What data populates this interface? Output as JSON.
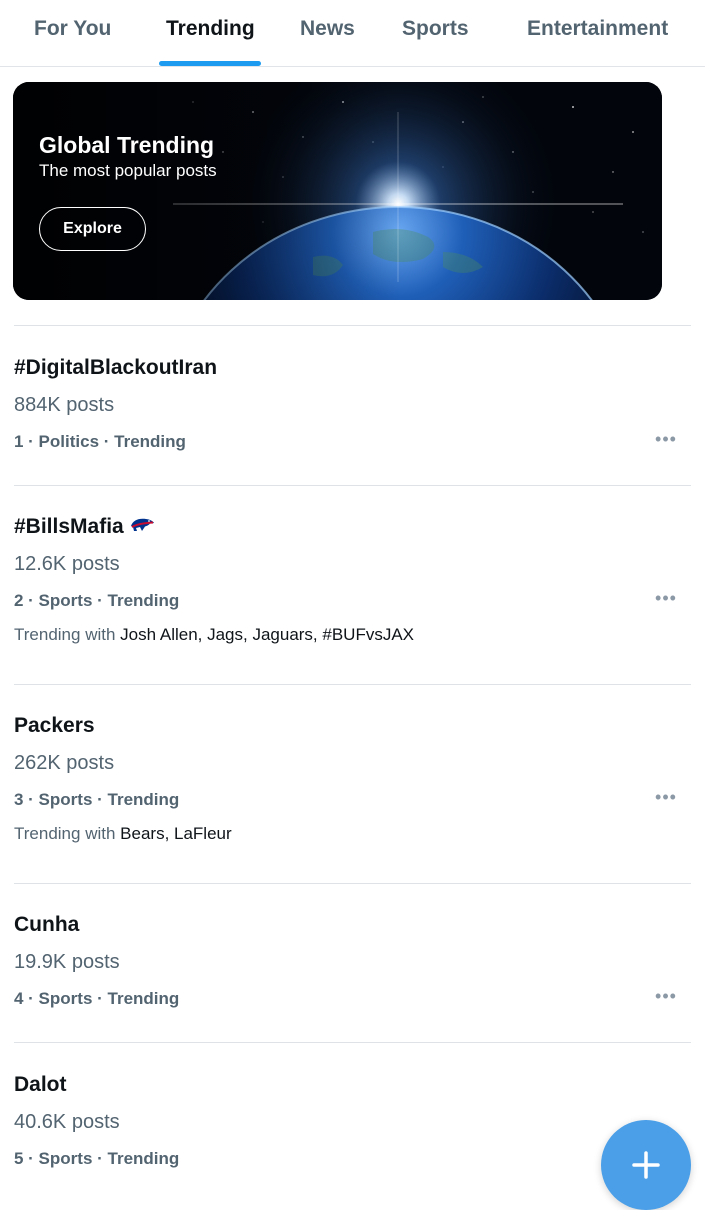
{
  "tabs": [
    {
      "label": "For You"
    },
    {
      "label": "Trending"
    },
    {
      "label": "News"
    },
    {
      "label": "Sports"
    },
    {
      "label": "Entertainment"
    }
  ],
  "active_tab": "Trending",
  "banner": {
    "title": "Global Trending",
    "subtitle": "The most popular posts",
    "button_label": "Explore",
    "image": "earth-from-space"
  },
  "trends": [
    {
      "name": "#DigitalBlackoutIran",
      "count": "884K posts",
      "meta": "1 · Politics · Trending",
      "with_prefix": "",
      "with_names": ""
    },
    {
      "name": "#BillsMafia",
      "count": "12.6K posts",
      "meta": "2 · Sports · Trending",
      "with_prefix": "Trending with",
      "with_names": "Josh Allen, Jags, Jaguars, #BUFvsJAX",
      "icon": "buffalo-bills-logo"
    },
    {
      "name": "Packers",
      "count": "262K posts",
      "meta": "3 · Sports · Trending",
      "with_prefix": "Trending with",
      "with_names": "Bears, LaFleur"
    },
    {
      "name": "Cunha",
      "count": "19.9K posts",
      "meta": "4 · Sports · Trending",
      "with_prefix": "",
      "with_names": ""
    },
    {
      "name": "Dalot",
      "count": "40.6K posts",
      "meta": "5 · Sports · Trending",
      "with_prefix": "",
      "with_names": ""
    }
  ],
  "more_label": "•••",
  "fab": {
    "icon": "plus-icon"
  },
  "colors": {
    "accent": "#1d9bf0",
    "fab": "#4a9fe8",
    "secondary_text": "#536471"
  }
}
